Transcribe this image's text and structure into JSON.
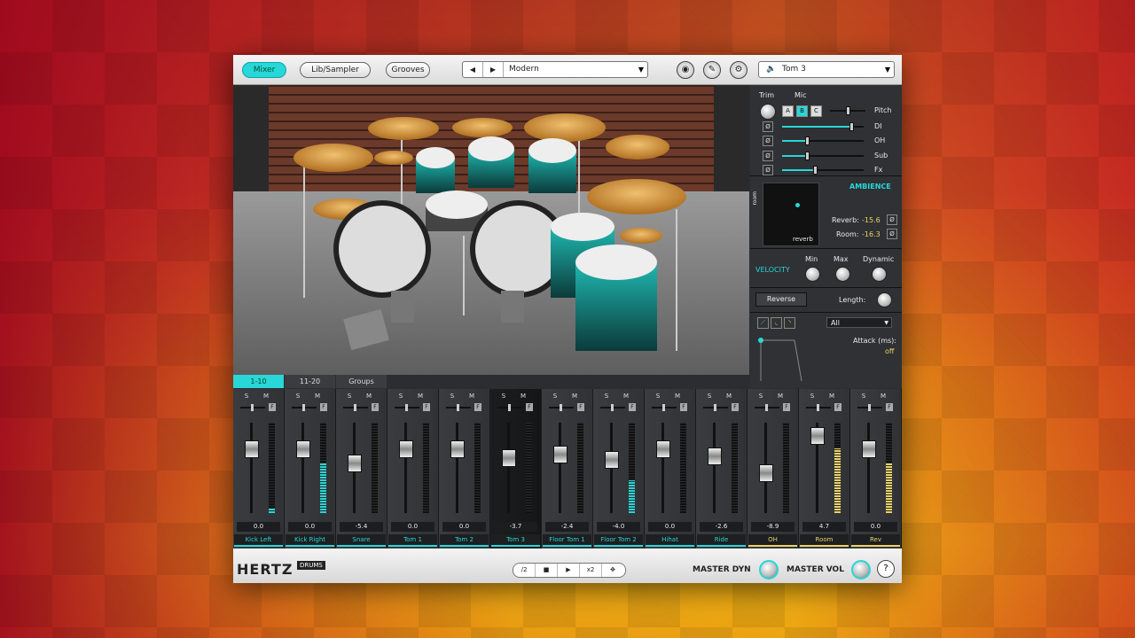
{
  "topbar": {
    "tabs": [
      {
        "label": "Mixer",
        "active": true
      },
      {
        "label": "Lib/Sampler",
        "active": false
      },
      {
        "label": "Grooves",
        "active": false
      }
    ],
    "prev_icon": "◀",
    "next_icon": "▶",
    "preset": "Modern",
    "dropdown_icon": "▼",
    "icons": [
      "record-icon",
      "drum-sticks-icon",
      "gear-icon"
    ],
    "instrument": "Tom 3"
  },
  "kit_tabs": [
    {
      "label": "1-10",
      "active": true
    },
    {
      "label": "11-20",
      "active": false
    },
    {
      "label": "Groups",
      "active": false
    }
  ],
  "right_panel": {
    "trim_label": "Trim",
    "mic_label": "Mic",
    "mic_buttons": [
      "A",
      "B",
      "C"
    ],
    "mic_selected": "B",
    "pitch_label": "Pitch",
    "phase_symbol": "Ø",
    "sends": [
      {
        "label": "DI",
        "level": 0.85
      },
      {
        "label": "OH",
        "level": 0.3
      },
      {
        "label": "Sub",
        "level": 0.3
      },
      {
        "label": "Fx",
        "level": 0.4
      }
    ],
    "pitch_level": 0.5,
    "ambience_label": "AMBIENCE",
    "xy_y_label": "room",
    "xy_x_label": "reverb",
    "reverb_label": "Reverb:",
    "reverb_value": "-15.6",
    "room_label": "Room:",
    "room_value": "-16.3",
    "velocity_label": "VELOCITY",
    "min_label": "Min",
    "max_label": "Max",
    "dynamic_label": "Dynamic",
    "reverse_label": "Reverse",
    "length_label": "Length:",
    "env_select": "All",
    "attack_label": "Attack (ms):",
    "attack_value": "off"
  },
  "mixer": {
    "solo_label": "S",
    "mute_label": "M",
    "f_label": "F",
    "channels": [
      {
        "name": "Kick Left",
        "value": "0.0",
        "fader": 0.72,
        "meter": 0.05,
        "color": "cyan"
      },
      {
        "name": "Kick Right",
        "value": "0.0",
        "fader": 0.72,
        "meter": 0.55,
        "color": "cyan"
      },
      {
        "name": "Snare",
        "value": "-5.4",
        "fader": 0.56,
        "meter": 0.0,
        "color": "cyan"
      },
      {
        "name": "Tom 1",
        "value": "0.0",
        "fader": 0.72,
        "meter": 0.0,
        "color": "cyan"
      },
      {
        "name": "Tom 2",
        "value": "0.0",
        "fader": 0.72,
        "meter": 0.0,
        "color": "cyan"
      },
      {
        "name": "Tom 3",
        "value": "-3.7",
        "fader": 0.62,
        "meter": 0.0,
        "color": "cyan",
        "selected": true
      },
      {
        "name": "Floor Tom 1",
        "value": "-2.4",
        "fader": 0.66,
        "meter": 0.0,
        "color": "cyan"
      },
      {
        "name": "Floor Tom 2",
        "value": "-4.0",
        "fader": 0.6,
        "meter": 0.36,
        "color": "cyan"
      },
      {
        "name": "Hihat",
        "value": "0.0",
        "fader": 0.72,
        "meter": 0.0,
        "color": "cyan"
      },
      {
        "name": "Ride",
        "value": "-2.6",
        "fader": 0.64,
        "meter": 0.0,
        "color": "cyan"
      },
      {
        "name": "OH",
        "value": "-8.9",
        "fader": 0.45,
        "meter": 0.0,
        "color": "yellow"
      },
      {
        "name": "Room",
        "value": "4.7",
        "fader": 0.86,
        "meter": 0.72,
        "color": "yellow"
      },
      {
        "name": "Rev",
        "value": "0.0",
        "fader": 0.72,
        "meter": 0.55,
        "color": "yellow"
      }
    ]
  },
  "bottom": {
    "logo": "HERTZ",
    "logo_sub": "DRUMS",
    "transport": [
      "/2",
      "■",
      "▶",
      "x2",
      "✥"
    ],
    "master_dyn": "MASTER DYN",
    "master_vol": "MASTER VOL",
    "help": "?"
  },
  "colors": {
    "accent": "#29d6d8",
    "yellow": "#e9d26a"
  }
}
